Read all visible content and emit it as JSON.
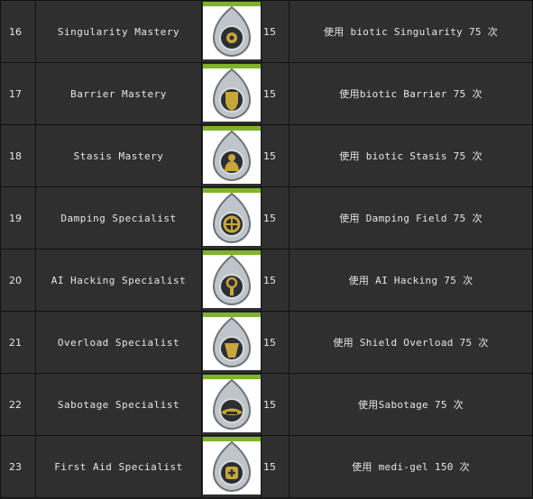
{
  "rows": [
    {
      "num": "16",
      "name": "Singularity Mastery",
      "points": "15",
      "desc": "使用 biotic Singularity 75 次",
      "icon": "singularity-emblem"
    },
    {
      "num": "17",
      "name": "Barrier Mastery",
      "points": "15",
      "desc": "使用biotic Barrier 75 次",
      "icon": "barrier-shield-emblem"
    },
    {
      "num": "18",
      "name": "Stasis Mastery",
      "points": "15",
      "desc": "使用 biotic Stasis 75 次",
      "icon": "stasis-figure-emblem"
    },
    {
      "num": "19",
      "name": "Damping Specialist",
      "points": "15",
      "desc": "使用 Damping Field 75 次",
      "icon": "damping-emblem"
    },
    {
      "num": "20",
      "name": "AI Hacking Specialist",
      "points": "15",
      "desc": "使用 AI Hacking 75 次",
      "icon": "ai-hacking-emblem"
    },
    {
      "num": "21",
      "name": "Overload Specialist",
      "points": "15",
      "desc": "使用 Shield Overload 75 次",
      "icon": "overload-emblem"
    },
    {
      "num": "22",
      "name": "Sabotage Specialist",
      "points": "15",
      "desc": "使用Sabotage 75 次",
      "icon": "sabotage-emblem"
    },
    {
      "num": "23",
      "name": "First Aid Specialist",
      "points": "15",
      "desc": "使用 medi-gel 150 次",
      "icon": "first-aid-emblem"
    }
  ],
  "colors": {
    "accent": "#7fb32a",
    "gold": "#c9a63a",
    "silver": "#c9ced3"
  }
}
